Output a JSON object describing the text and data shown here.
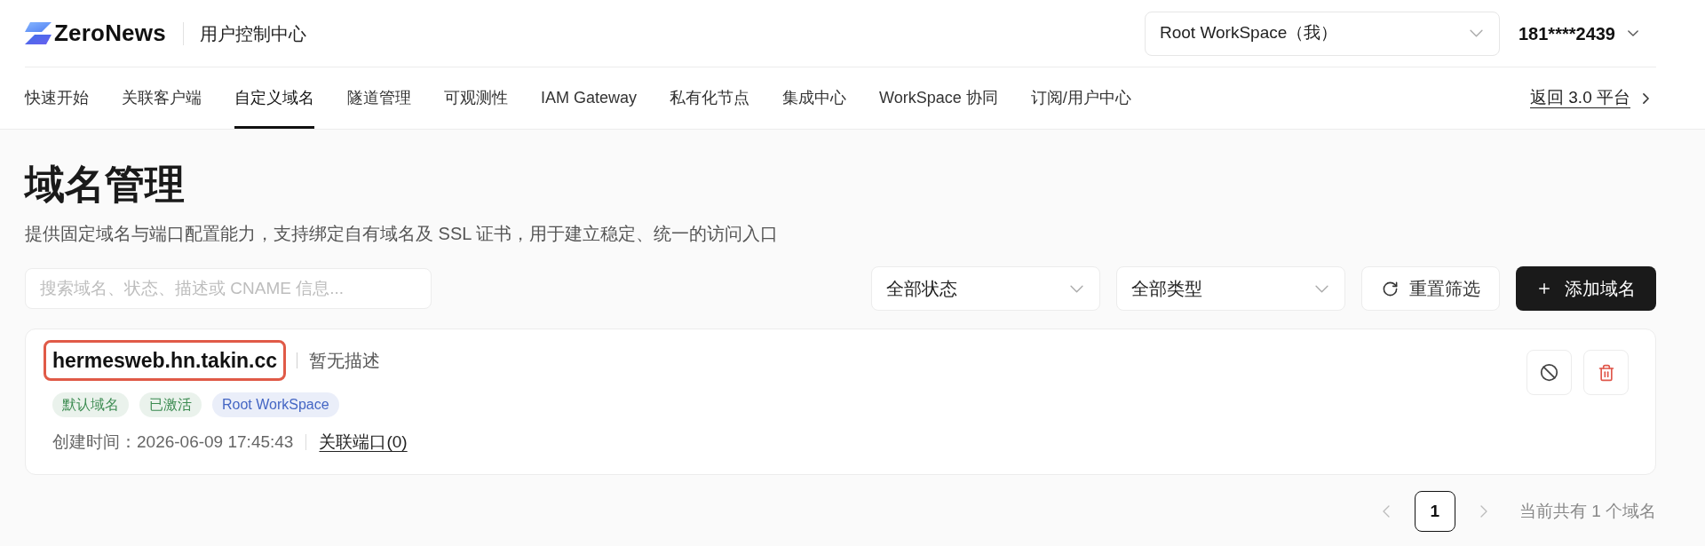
{
  "header": {
    "logo": "ZeroNews",
    "subtitle": "用户控制中心",
    "workspace_select": {
      "value": "Root WorkSpace（我）"
    },
    "user": "181****2439"
  },
  "nav": {
    "tabs": [
      {
        "label": "快速开始",
        "selected": false
      },
      {
        "label": "关联客户端",
        "selected": false
      },
      {
        "label": "自定义域名",
        "selected": true
      },
      {
        "label": "隧道管理",
        "selected": false
      },
      {
        "label": "可观测性",
        "selected": false
      },
      {
        "label": "IAM Gateway",
        "selected": false
      },
      {
        "label": "私有化节点",
        "selected": false
      },
      {
        "label": "集成中心",
        "selected": false
      },
      {
        "label": "WorkSpace 协同",
        "selected": false
      },
      {
        "label": "订阅/用户中心",
        "selected": false
      }
    ],
    "back_link": "返回 3.0 平台"
  },
  "page": {
    "title": "域名管理",
    "description": "提供固定域名与端口配置能力，支持绑定自有域名及 SSL 证书，用于建立稳定、统一的访问入口"
  },
  "filters": {
    "search": {
      "placeholder": "搜索域名、状态、描述或 CNAME 信息..."
    },
    "status_select": {
      "value": "全部状态"
    },
    "type_select": {
      "value": "全部类型"
    },
    "reset_button": "重置筛选",
    "add_button": "添加域名"
  },
  "domains": [
    {
      "name": "hermesweb.hn.takin.cc",
      "highlighted": true,
      "description": "暂无描述",
      "tags": [
        {
          "label": "默认域名",
          "color": "#3d8c52"
        },
        {
          "label": "已激活",
          "color": "#3d8c52"
        },
        {
          "label": "Root WorkSpace",
          "color": "#4466c4"
        }
      ],
      "created_at": "创建时间：2026-06-09 17:45:43",
      "ports_link": "关联端口(0)"
    }
  ],
  "pagination": {
    "prev": {
      "disabled": true
    },
    "pages": [
      {
        "label": "1",
        "selected": true
      }
    ],
    "next": {
      "disabled": true
    },
    "summary": "当前共有 1 个域名"
  }
}
